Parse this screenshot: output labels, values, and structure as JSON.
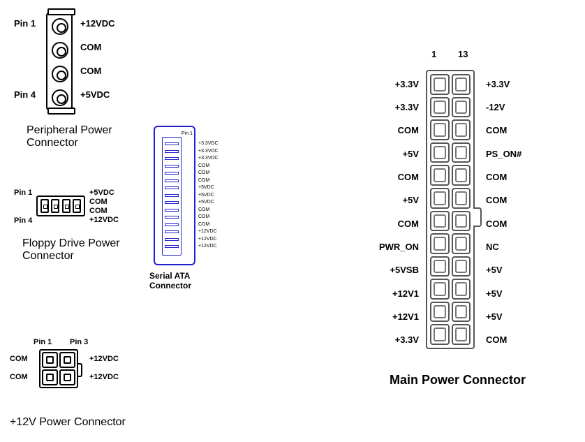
{
  "peripheral": {
    "title": "Peripheral Power Connector",
    "pin1_marker": "Pin 1",
    "pin4_marker": "Pin 4",
    "pins": [
      "+12VDC",
      "COM",
      "COM",
      "+5VDC"
    ]
  },
  "floppy": {
    "title": "Floppy Drive Power Connector",
    "pin1_marker": "Pin 1",
    "pin4_marker": "Pin 4",
    "pins": [
      "+5VDC",
      "COM",
      "COM",
      "+12VDC"
    ]
  },
  "p12v": {
    "title": "+12V Power Connector",
    "pin1_marker": "Pin 1",
    "pin3_marker": "Pin 3",
    "left": [
      "COM",
      "COM"
    ],
    "right": [
      "+12VDC",
      "+12VDC"
    ]
  },
  "sata": {
    "title": "Serial ATA Connector",
    "pin1_marker": "Pin 1",
    "pins": [
      "+3.3VDC",
      "+3.3VDC",
      "+3.3VDC",
      "COM",
      "COM",
      "COM",
      "+5VDC",
      "+5VDC",
      "+5VDC",
      "COM",
      "COM",
      "COM",
      "+12VDC",
      "+12VDC",
      "+12VDC"
    ]
  },
  "atx": {
    "title": "Main Power Connector",
    "col1_marker": "1",
    "col13_marker": "13",
    "left": [
      "+3.3V",
      "+3.3V",
      "COM",
      "+5V",
      "COM",
      "+5V",
      "COM",
      "PWR_ON",
      "+5VSB",
      "+12V1",
      "+12V1",
      "+3.3V"
    ],
    "right": [
      "+3.3V",
      "-12V",
      "COM",
      "PS_ON#",
      "COM",
      "COM",
      "COM",
      "NC",
      "+5V",
      "+5V",
      "+5V",
      "COM"
    ]
  }
}
